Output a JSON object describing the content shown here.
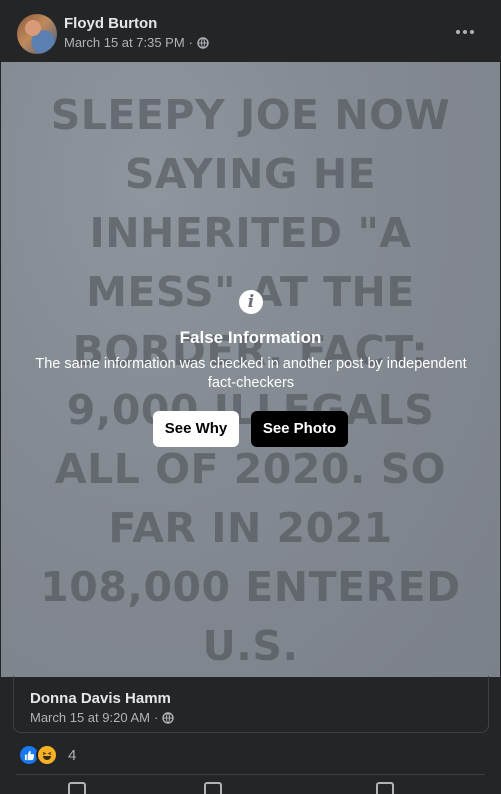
{
  "post": {
    "author": "Floyd Burton",
    "timestamp": "March 15 at 7:35 PM",
    "privacy_icon": "globe-icon"
  },
  "photo": {
    "text_lines": [
      "SLEEPY JOE NOW",
      "SAYING HE",
      "INHERITED \"A",
      "MESS\" AT THE",
      "BORDER. FACT:",
      "9,000 ILLEGALS",
      "ALL OF 2020. SO",
      "FAR IN 2021",
      "108,000 ENTERED",
      "U.S."
    ]
  },
  "fact_check": {
    "title": "False Information",
    "description": "The same information was checked in another post by independent fact-checkers",
    "see_why_label": "See Why",
    "see_photo_label": "See Photo"
  },
  "shared_post": {
    "author": "Donna Davis Hamm",
    "timestamp": "March 15 at 9:20 AM"
  },
  "reactions": {
    "types": [
      "like-icon",
      "haha-icon"
    ],
    "count": "4"
  },
  "colors": {
    "background": "#242526",
    "primary_text": "#e4e6eb",
    "secondary_text": "#b0b3b8",
    "like_blue": "#1877f2"
  }
}
